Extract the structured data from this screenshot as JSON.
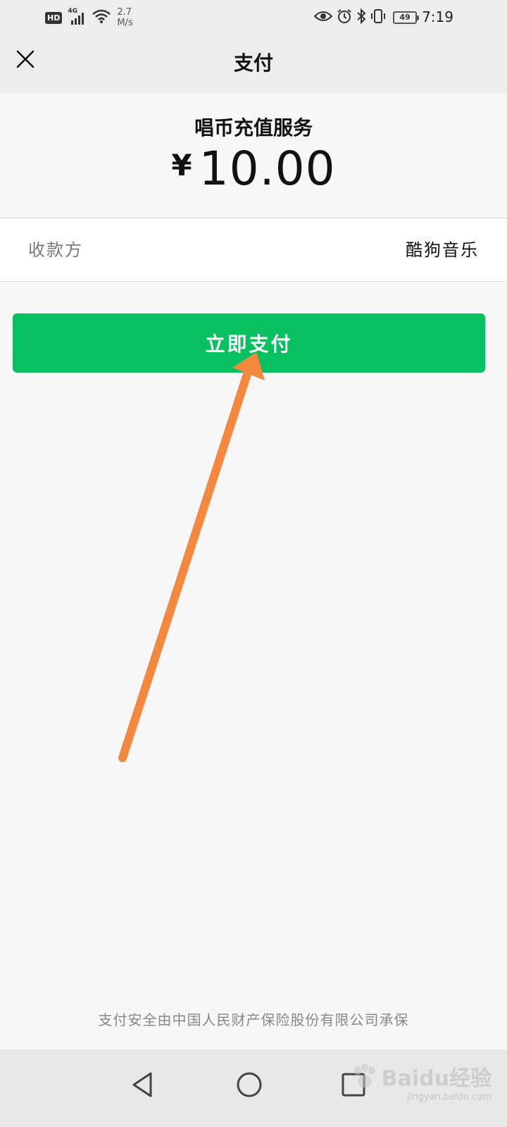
{
  "status_bar": {
    "hd_badge": "HD",
    "network_type": "4G",
    "speed_value": "2.7",
    "speed_unit": "M/s",
    "battery_level": "49",
    "time": "7:19",
    "icons": [
      "eye-icon",
      "alarm-icon",
      "bluetooth-icon",
      "vibrate-icon",
      "battery-icon"
    ]
  },
  "header": {
    "title": "支付",
    "close_icon": "close-icon"
  },
  "order": {
    "service_name": "唱币充值服务",
    "currency_symbol": "¥",
    "amount": "10.00"
  },
  "payee": {
    "label": "收款方",
    "value": "酷狗音乐"
  },
  "actions": {
    "pay_label": "立即支付"
  },
  "footer": {
    "note": "支付安全由中国人民财产保险股份有限公司承保"
  },
  "nav_bar": {
    "buttons": [
      "back-icon",
      "home-icon",
      "recent-apps-icon"
    ]
  },
  "watermark": {
    "text": "Baidu经验",
    "sub": "jingyan.baidu.com"
  },
  "colors": {
    "accent": "#07c160",
    "arrow": "#f5883f",
    "header_bg": "#ededed",
    "page_bg": "#f7f7f7"
  }
}
